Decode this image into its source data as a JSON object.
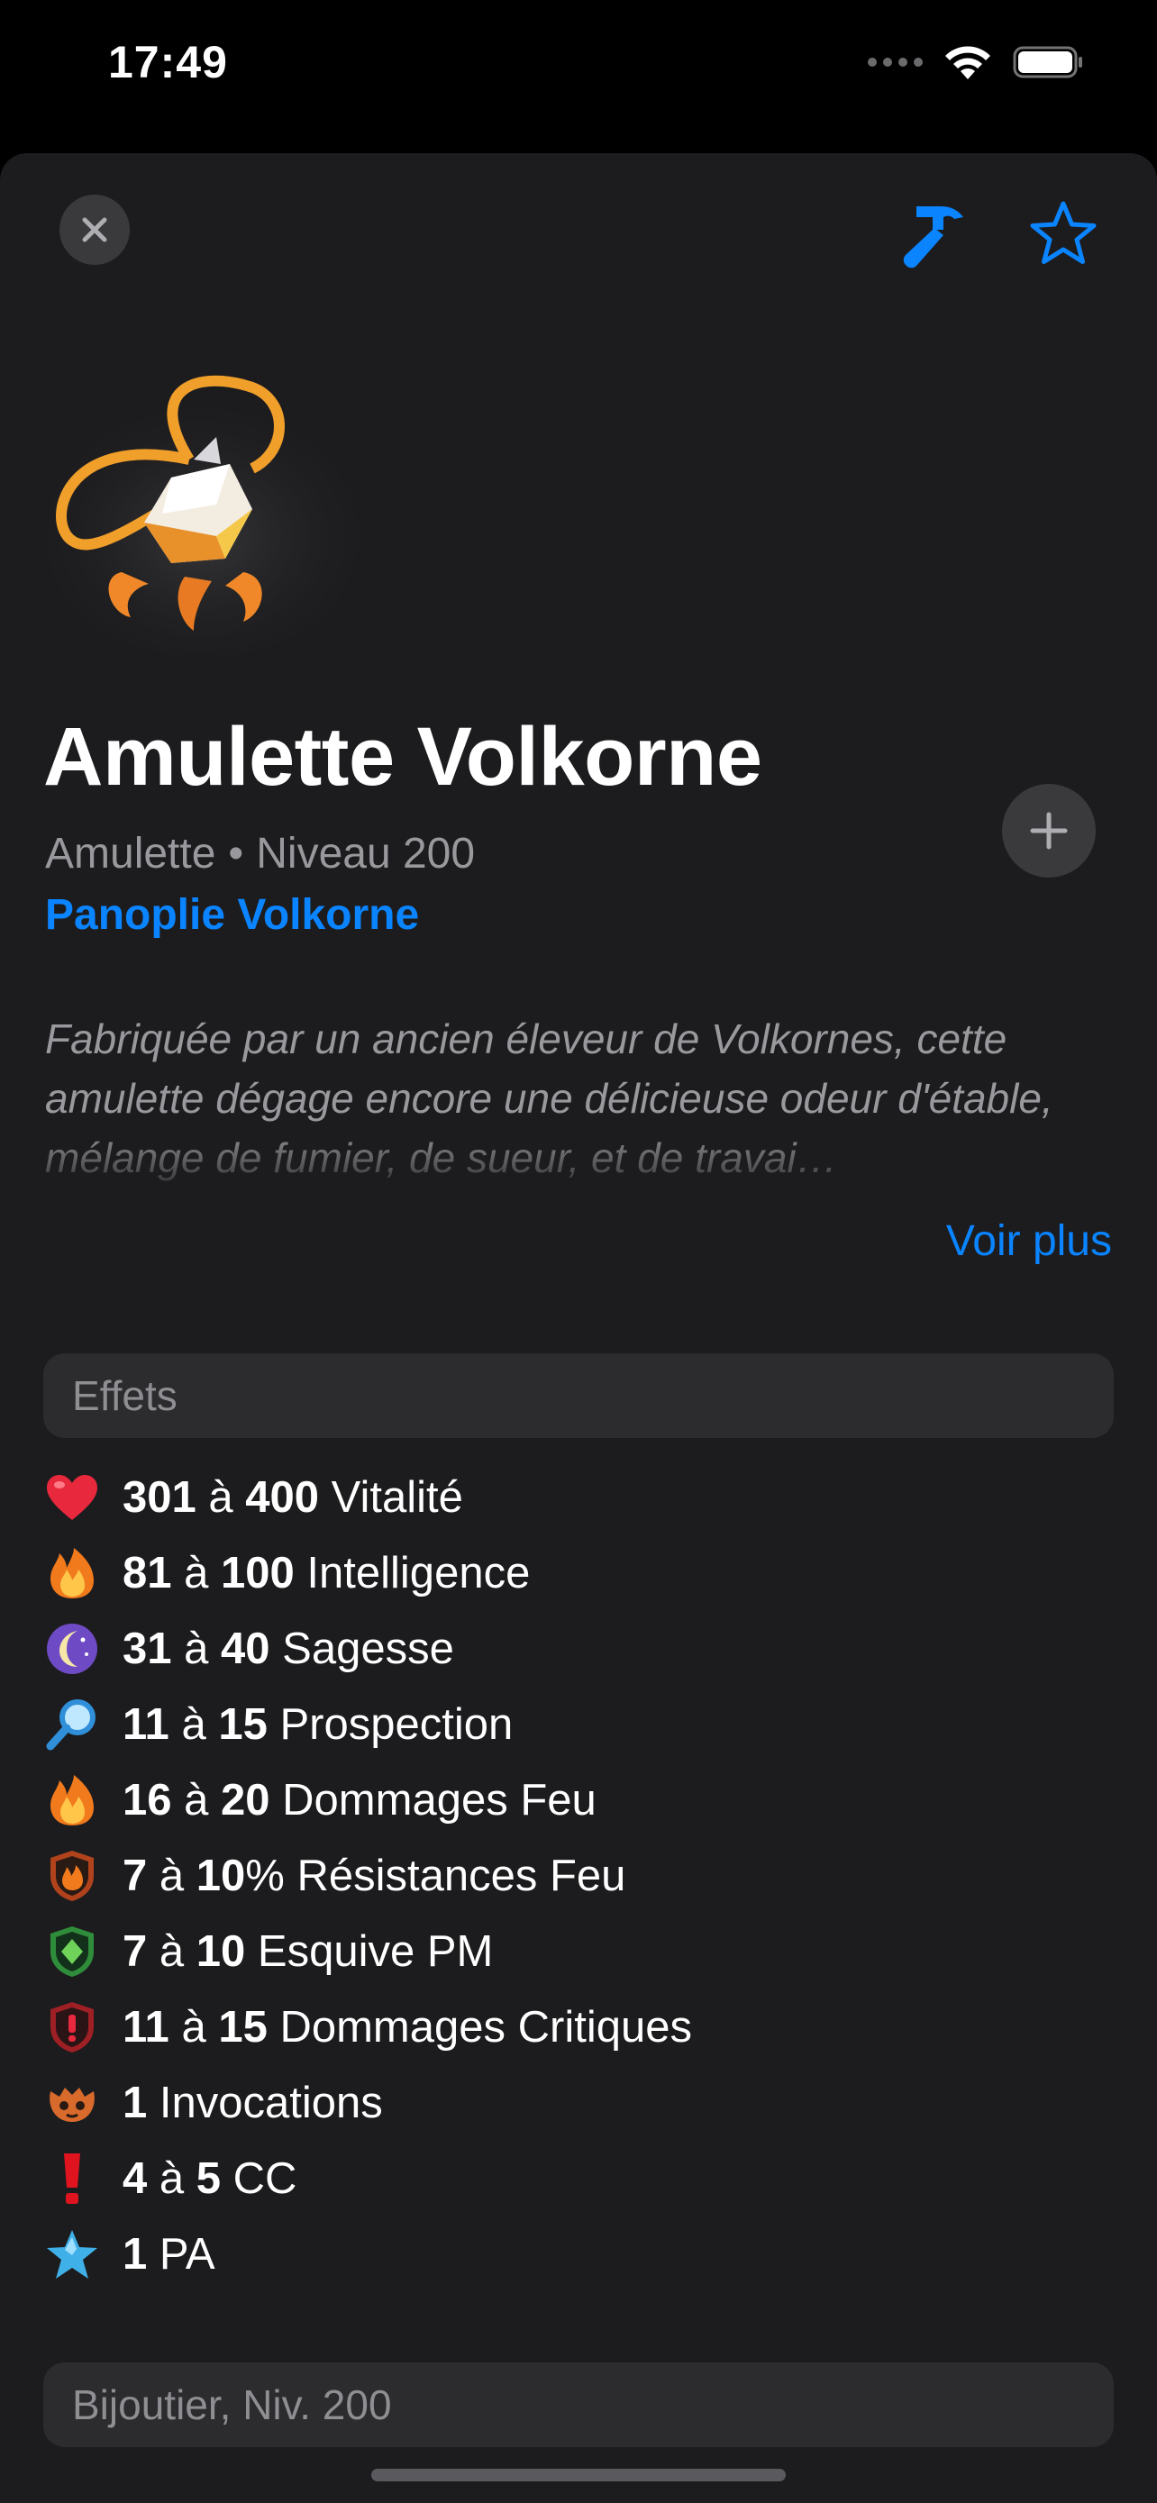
{
  "status_bar": {
    "time": "17:49"
  },
  "toolbar": {
    "close_icon": "close-icon",
    "craft_icon": "hammer-icon",
    "favorite_icon": "star-icon",
    "accent_color": "#0a84ff"
  },
  "item": {
    "name": "Amulette Volkorne",
    "type": "Amulette",
    "separator": "•",
    "level": "Niveau 200",
    "set_name": "Panoplie Volkorne",
    "description": "Fabriquée par un ancien éleveur de Volkornes, cette amulette dégage encore une délicieuse odeur d'étable, mélange de fumier, de sueur, et de travai…",
    "see_more_label": "Voir plus"
  },
  "effects": {
    "header": "Effets",
    "items": [
      {
        "icon": "heart-icon",
        "min": "301",
        "sep": "à",
        "max": "400",
        "label": "Vitalité"
      },
      {
        "icon": "fire-icon",
        "min": "81",
        "sep": "à",
        "max": "100",
        "label": "Intelligence"
      },
      {
        "icon": "moon-icon",
        "min": "31",
        "sep": "à",
        "max": "40",
        "label": "Sagesse"
      },
      {
        "icon": "magnifier-icon",
        "min": "11",
        "sep": "à",
        "max": "15",
        "label": "Prospection"
      },
      {
        "icon": "fire-icon",
        "min": "16",
        "sep": "à",
        "max": "20",
        "label": "Dommages Feu"
      },
      {
        "icon": "fire-shield-icon",
        "min": "7",
        "sep": "à",
        "max": "10",
        "label": "% Résistances Feu"
      },
      {
        "icon": "green-shield-icon",
        "min": "7",
        "sep": "à",
        "max": "10",
        "label": "Esquive PM"
      },
      {
        "icon": "critical-shield-icon",
        "min": "11",
        "sep": "à",
        "max": "15",
        "label": "Dommages Critiques"
      },
      {
        "icon": "summon-icon",
        "min": "1",
        "sep": "",
        "max": "",
        "label": "Invocations"
      },
      {
        "icon": "exclamation-icon",
        "min": "4",
        "sep": "à",
        "max": "5",
        "label": "CC"
      },
      {
        "icon": "blue-star-icon",
        "min": "1",
        "sep": "",
        "max": "",
        "label": "PA"
      }
    ]
  },
  "recipe": {
    "header": "Bijoutier, Niv. 200"
  }
}
